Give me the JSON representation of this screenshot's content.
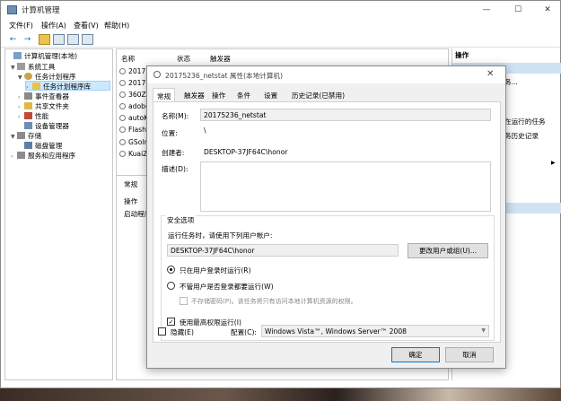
{
  "window": {
    "title": "计算机管理",
    "min": "—",
    "max": "☐",
    "close": "✕"
  },
  "menu": [
    "文件(F)",
    "操作(A)",
    "查看(V)",
    "帮助(H)"
  ],
  "toolbar": {
    "back": "←",
    "forward": "→"
  },
  "tree": [
    {
      "label": "计算机管理(本地)",
      "expander": "",
      "icon": "computer-icon"
    },
    {
      "label": "系统工具",
      "expander": "▼",
      "icon": "tools-icon"
    },
    {
      "label": "任务计划程序",
      "expander": "▼",
      "icon": "clock-icon"
    },
    {
      "label": "任务计划程序库",
      "expander": "›",
      "icon": "folder-icon"
    },
    {
      "label": "事件查看器",
      "expander": "›",
      "icon": "event-viewer-icon"
    },
    {
      "label": "共享文件夹",
      "expander": "›",
      "icon": "shared-folder-icon"
    },
    {
      "label": "性能",
      "expander": "›",
      "icon": "performance-icon"
    },
    {
      "label": "设备管理器",
      "expander": "",
      "icon": "device-manager-icon"
    },
    {
      "label": "存储",
      "expander": "▼",
      "icon": "storage-icon"
    },
    {
      "label": "磁盘管理",
      "expander": "",
      "icon": "disk-icon"
    },
    {
      "label": "服务和应用程序",
      "expander": "›",
      "icon": "services-icon"
    }
  ],
  "list": {
    "columns": [
      "名称",
      "状态",
      "触发器"
    ],
    "rows": [
      "20175",
      "20175",
      "360Z",
      "adobe",
      "autoK",
      "Flash",
      "GSoln",
      "KuaiZ"
    ],
    "lower_tabs": [
      "常规",
      "操作",
      "启动程序"
    ]
  },
  "actions": {
    "header": "操作",
    "items": [
      "务...",
      "在运行的任务",
      "务历史记录"
    ]
  },
  "dialog": {
    "title": "20175236_netstat 属性(本地计算机)",
    "close": "✕",
    "tabs": [
      "常规",
      "触发器",
      "操作",
      "条件",
      "设置",
      "历史记录(已禁用)"
    ],
    "name_label": "名称(M):",
    "name_value": "20175236_netstat",
    "location_label": "位置:",
    "location_value": "\\",
    "author_label": "创建者:",
    "author_value": "DESKTOP-37JF64C\\honor",
    "description_label": "描述(D):",
    "security_title": "安全选项",
    "run_as_label": "运行任务时，请使用下列用户帐户:",
    "run_as_value": "DESKTOP-37JF64C\\honor",
    "change_user_button": "更改用户或组(U)...",
    "radio_logged_on": "只在用户登录时运行(R)",
    "radio_whether": "不管用户是否登录都要运行(W)",
    "no_store_password": "不存储密码(P)。该任务将只有访问本地计算机资源的权限。",
    "highest_privileges": "使用最高权限运行(I)",
    "hidden_label": "隐藏(E)",
    "configure_label": "配置(C):",
    "configure_value": "Windows Vista™, Windows Server™ 2008",
    "ok_button": "确定",
    "cancel_button": "取消",
    "check_mark": "✓"
  }
}
